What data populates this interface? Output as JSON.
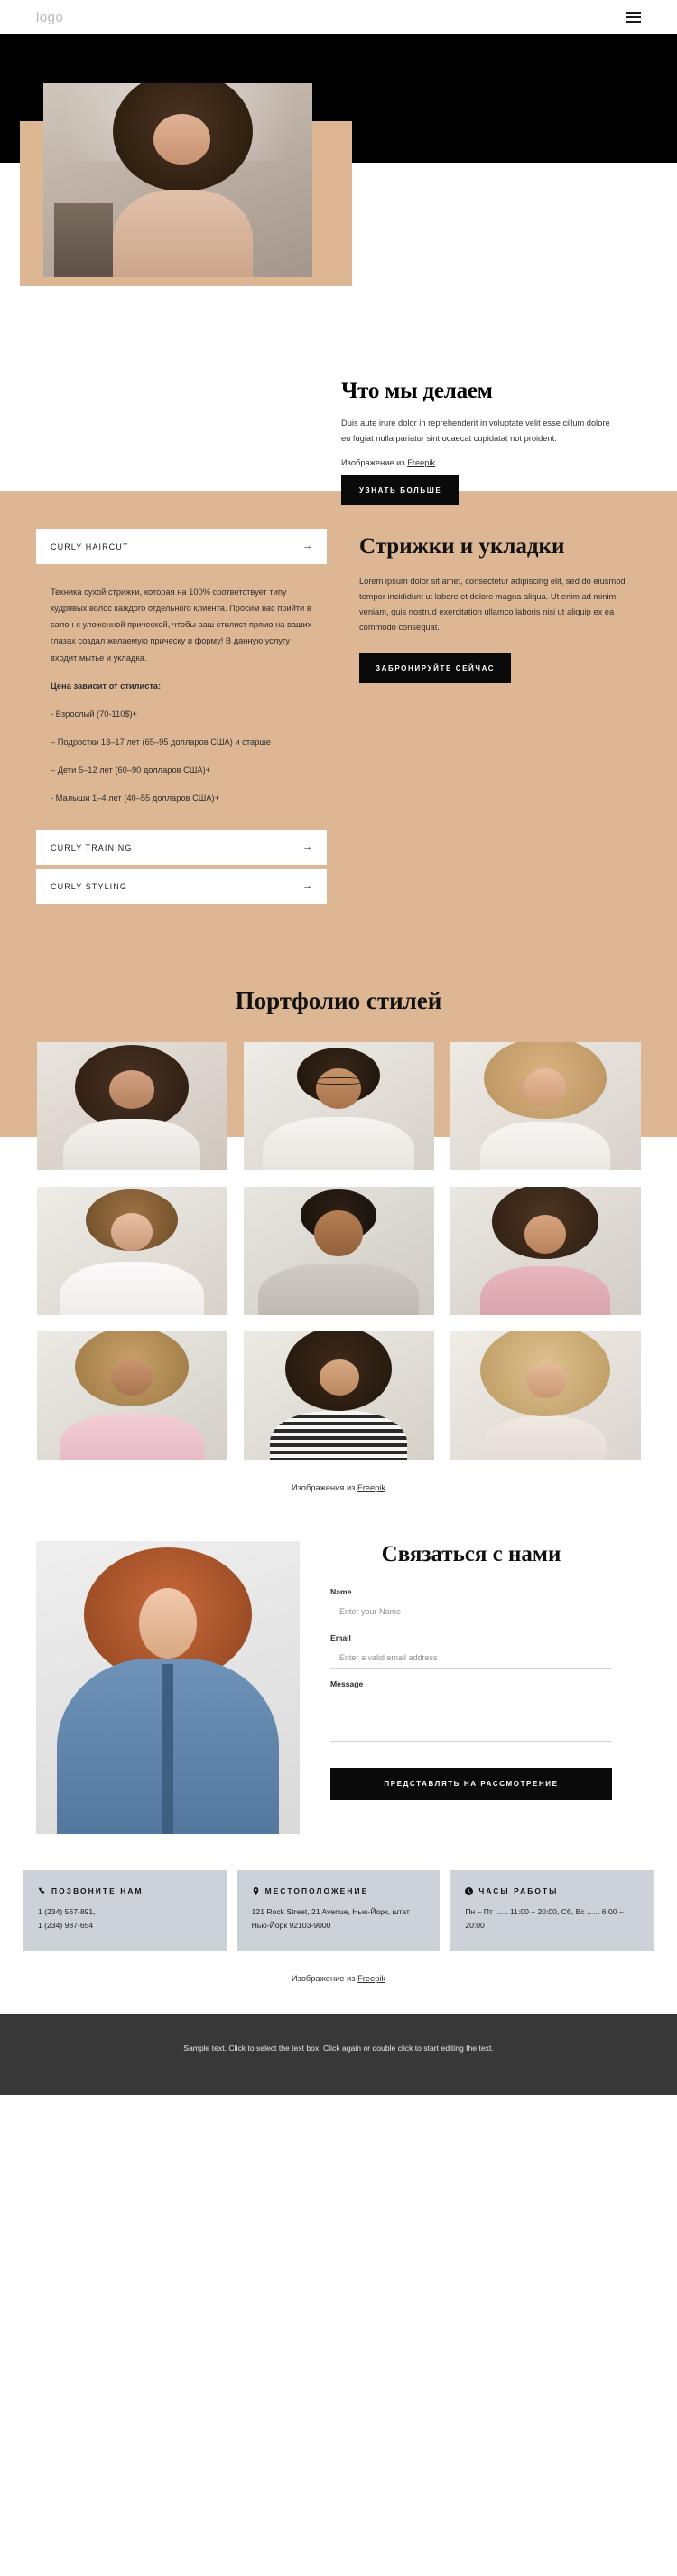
{
  "header": {
    "logo": "logo",
    "menu_icon": "hamburger-icon"
  },
  "hero": {
    "title": "Что мы делаем",
    "paragraph": "Duis aute irure dolor in reprehenderit in voluptate velit esse cillum dolore eu fugiat nulla pariatur sint ocaecat cupidatat not proident.",
    "credit_prefix": "Изображение из ",
    "credit_link": "Freepik",
    "button": "УЗНАТЬ БОЛЬШЕ"
  },
  "services": {
    "accordion": [
      {
        "label": "CURLY HAIRCUT",
        "arrow": "→",
        "open": true
      },
      {
        "label": "CURLY TRAINING",
        "arrow": "→",
        "open": false
      },
      {
        "label": "CURLY STYLING",
        "arrow": "→",
        "open": false
      }
    ],
    "body": {
      "intro": "Техника сухой стрижки, которая на 100% соответствует типу кудрявых волос каждого отдельного клиента. Просим вас прийти в салон с уложенной прической, чтобы ваш стилист прямо на ваших глазах создал желаемую прическу и форму! В данную услугу входит мытье и укладка.",
      "price_heading": "Цена зависит от стилиста:",
      "price_items": [
        "- Взрослый (70-110$)+",
        "– Подростки 13–17 лет (65–95 долларов США) и старше",
        "– Дети 5–12 лет (60–90 долларов США)+",
        "- Малыши 1–4 лет (40–55 долларов США)+"
      ]
    },
    "heading": "Стрижки и укладки",
    "paragraph": "Lorem ipsum dolor sit amet, consectetur adipiscing elit, sed do eiusmod tempor incididunt ut labore et dolore magna aliqua. Ut enim ad minim veniam, quis nostrud exercitation ullamco laboris nisi ut aliquip ex ea commodo consequat.",
    "button": "ЗАБРОНИРУЙТЕ СЕЙЧАС"
  },
  "portfolio": {
    "title": "Портфолио стилей",
    "credit_prefix": "Изображения из ",
    "credit_link": "Freepik",
    "items": [
      {
        "alt": "woman-curly-afro-white-shirt"
      },
      {
        "alt": "man-glasses-white-sweater"
      },
      {
        "alt": "woman-blonde-curls-smiling"
      },
      {
        "alt": "woman-short-curls-white-shirt"
      },
      {
        "alt": "man-beard-grey-sweater"
      },
      {
        "alt": "woman-laughing-pink-top"
      },
      {
        "alt": "woman-curls-pink-sweater"
      },
      {
        "alt": "woman-striped-shirt-long-curls"
      },
      {
        "alt": "woman-long-blonde-curls"
      }
    ]
  },
  "contact": {
    "photo_alt": "woman-red-curly-hair-denim-jacket",
    "title": "Связаться с нами",
    "fields": [
      {
        "label": "Name",
        "placeholder": "Enter your Name",
        "value": "",
        "type": "text",
        "name": "name-field"
      },
      {
        "label": "Email",
        "placeholder": "Enter a valid email address",
        "value": "",
        "type": "email",
        "name": "email-field"
      },
      {
        "label": "Message",
        "placeholder": "",
        "value": "",
        "type": "textarea",
        "name": "message-field"
      }
    ],
    "submit": "ПРЕДСТАВЛЯТЬ НА РАССМОТРЕНИЕ"
  },
  "info": {
    "boxes": [
      {
        "icon": "phone-icon",
        "title": "ПОЗВОНИТЕ НАМ",
        "lines": [
          "1 (234) 567-891,",
          "1 (234) 987-654"
        ]
      },
      {
        "icon": "map-pin-icon",
        "title": "МЕСТОПОЛОЖЕНИЕ",
        "lines": [
          "121 Rock Street, 21 Avenue, Нью-Йорк, штат Нью-Йорк 92103-9000"
        ]
      },
      {
        "icon": "clock-icon",
        "title": "ЧАСЫ РАБОТЫ",
        "lines": [
          "Пн – Пт ...... 11:00 – 20:00, Сб, Вс ...... 6:00 – 20:00"
        ]
      }
    ],
    "credit_prefix": "Изображение из ",
    "credit_link": "Freepik"
  },
  "footer": {
    "text": "Sample text. Click to select the text box. Click again or double click to start editing the text."
  },
  "colors": {
    "beige": "#ddb794",
    "black": "#000000",
    "dark_button": "#0a0a0a",
    "info_box": "#cdd2d8",
    "footer": "#383838"
  }
}
